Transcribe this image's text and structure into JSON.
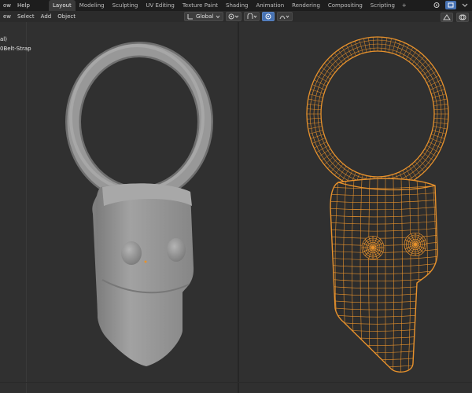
{
  "topbar": {
    "menus": [
      "ow",
      "Help"
    ],
    "tabs": [
      "Layout",
      "Modeling",
      "Sculpting",
      "UV Editing",
      "Texture Paint",
      "Shading",
      "Animation",
      "Rendering",
      "Compositing",
      "Scripting"
    ],
    "active_tab": "Layout",
    "add_tab_symbol": "+"
  },
  "header": {
    "menus": [
      "ew",
      "Select",
      "Add",
      "Object"
    ],
    "orientation": "Global"
  },
  "outliner": {
    "items": [
      "al)",
      "0Belt-Strap"
    ]
  },
  "colors": {
    "selection_wire": "#e8922c",
    "solid_mesh": "#9a9a9a",
    "background": "#303030",
    "accent": "#4772b3"
  },
  "icons": [
    "transform-pivot-icon",
    "snap-icon",
    "proportional-edit-icon",
    "falloff-icon",
    "viewport-gizmo-icon",
    "overlay-icon"
  ]
}
